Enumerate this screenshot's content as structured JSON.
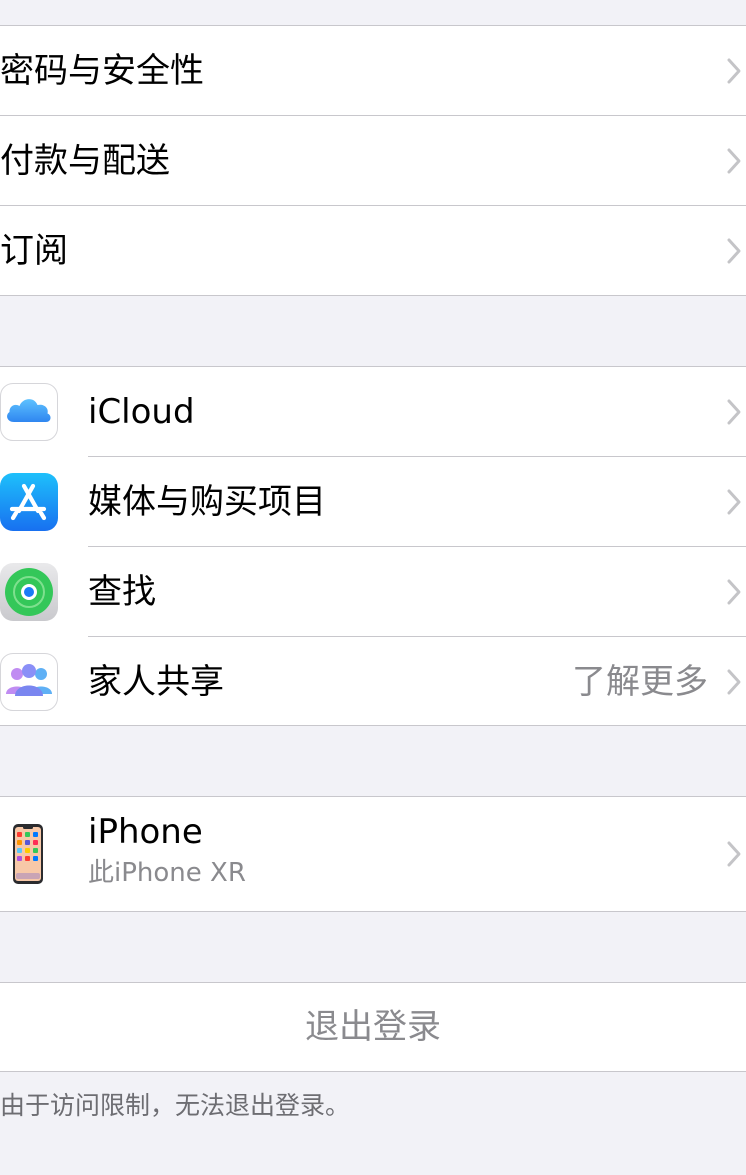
{
  "account_group": {
    "items": [
      {
        "label": "密码与安全性"
      },
      {
        "label": "付款与配送"
      },
      {
        "label": "订阅"
      }
    ]
  },
  "services_group": {
    "items": [
      {
        "label": "iCloud",
        "icon": "icloud-icon"
      },
      {
        "label": "媒体与购买项目",
        "icon": "app-store-icon"
      },
      {
        "label": "查找",
        "icon": "find-my-icon"
      },
      {
        "label": "家人共享",
        "icon": "family-sharing-icon",
        "detail": "了解更多"
      }
    ]
  },
  "devices_group": {
    "items": [
      {
        "title": "iPhone",
        "subtitle": "此iPhone XR",
        "icon": "iphone-device-icon"
      }
    ]
  },
  "sign_out": {
    "label": "退出登录",
    "note": "由于访问限制，无法退出登录。"
  },
  "colors": {
    "background": "#f2f2f7",
    "separator": "#c8c7cc",
    "secondary_text": "#8a8a8e",
    "chevron": "#c4c4c7"
  }
}
